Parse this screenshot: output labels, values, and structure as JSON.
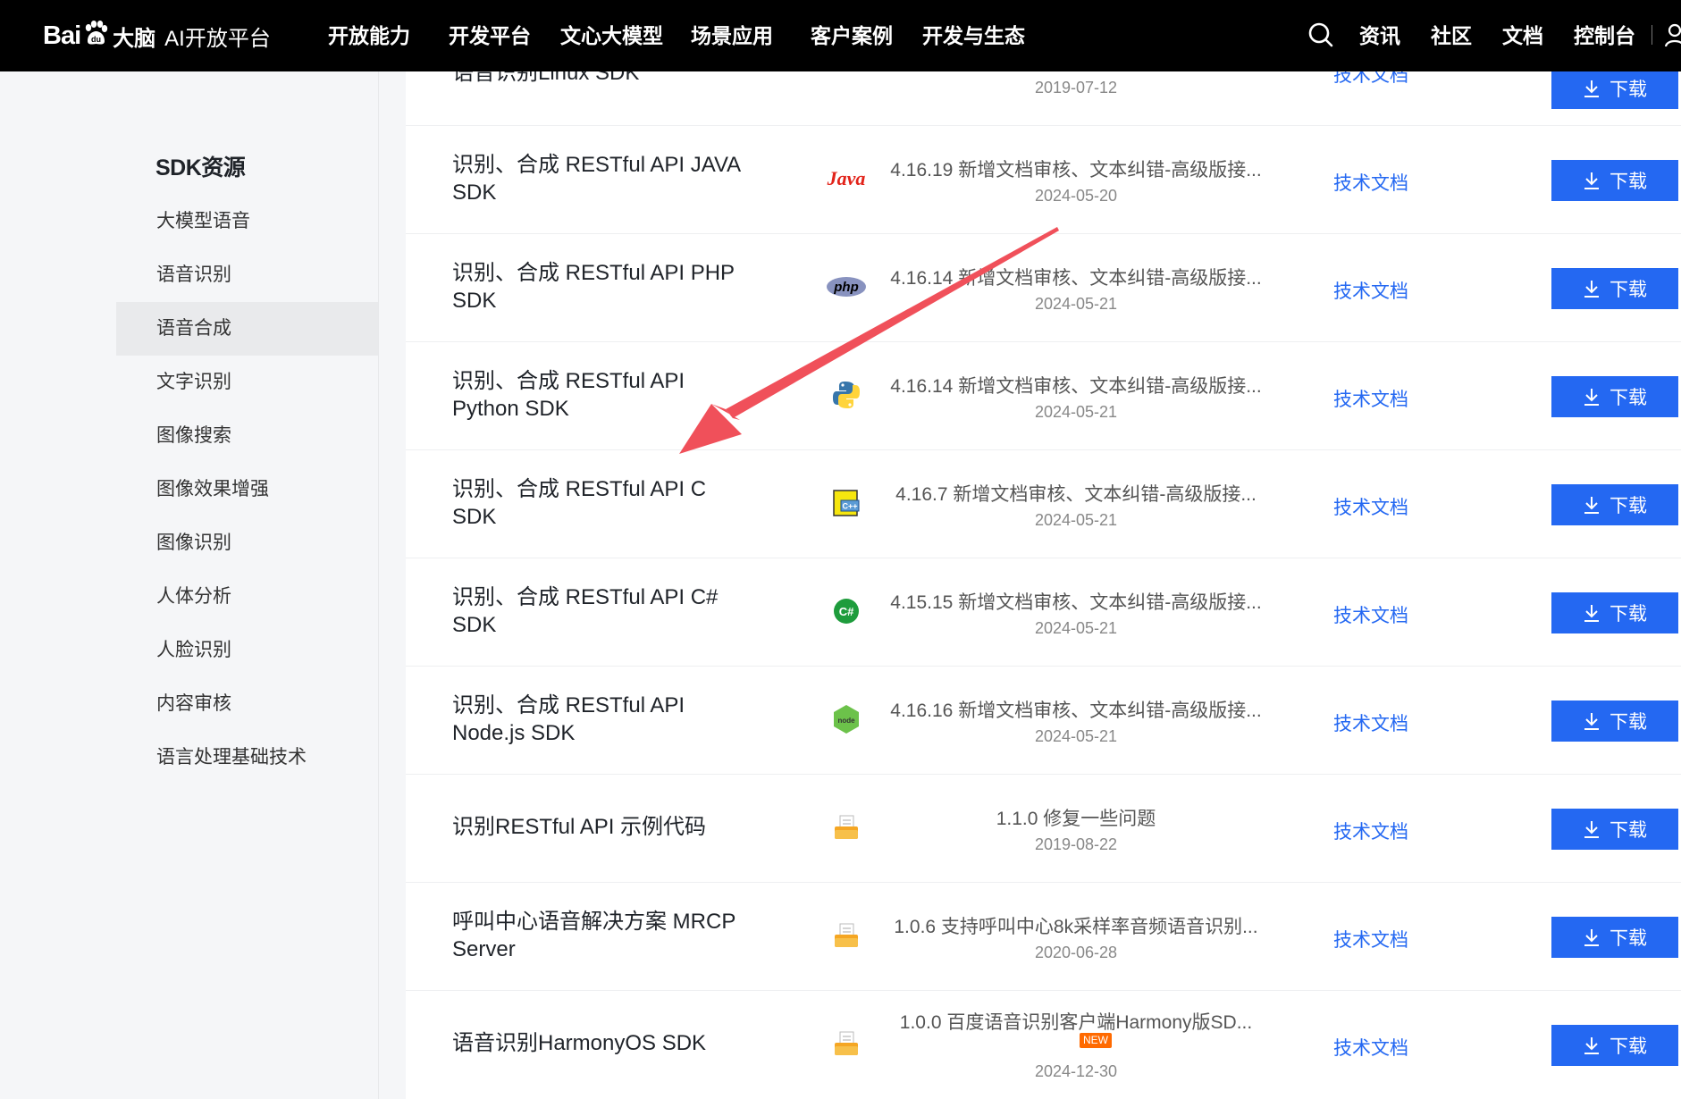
{
  "header": {
    "logo_bai": "Bai",
    "logo_du": "大脑",
    "logo_platform": "AI开放平台",
    "nav": [
      "开放能力",
      "开发平台",
      "文心大模型",
      "场景应用",
      "客户案例",
      "开发与生态"
    ],
    "right": [
      "资讯",
      "社区",
      "文档",
      "控制台"
    ]
  },
  "sidebar": {
    "title": "SDK资源",
    "items": [
      "大模型语音",
      "语音识别",
      "语音合成",
      "文字识别",
      "图像搜索",
      "图像效果增强",
      "图像识别",
      "人体分析",
      "人脸识别",
      "内容审核",
      "语言处理基础技术"
    ],
    "active_index": 2
  },
  "rows": [
    {
      "name": "语音识别Linux SDK",
      "icon": "linux-icon",
      "version": "",
      "date": "2019-07-12",
      "doc": "技术文档",
      "download": "下载"
    },
    {
      "name": "识别、合成 RESTful API JAVA SDK",
      "icon": "java-icon",
      "icon_text": "Java",
      "version": "4.16.19 新增文档审核、文本纠错-高级版接...",
      "date": "2024-05-20",
      "doc": "技术文档",
      "download": "下载"
    },
    {
      "name": "识别、合成 RESTful API PHP SDK",
      "icon": "php-icon",
      "icon_text": "php",
      "version": "4.16.14 新增文档审核、文本纠错-高级版接...",
      "date": "2024-05-21",
      "doc": "技术文档",
      "download": "下载"
    },
    {
      "name": "识别、合成 RESTful API Python SDK",
      "icon": "python-icon",
      "version": "4.16.14 新增文档审核、文本纠错-高级版接...",
      "date": "2024-05-21",
      "doc": "技术文档",
      "download": "下载"
    },
    {
      "name": "识别、合成 RESTful API C SDK",
      "icon": "cpp-icon",
      "icon_text": "C++",
      "version": "4.16.7 新增文档审核、文本纠错-高级版接...",
      "date": "2024-05-21",
      "doc": "技术文档",
      "download": "下载"
    },
    {
      "name": "识别、合成 RESTful API C# SDK",
      "icon": "csharp-icon",
      "icon_text": "C#",
      "version": "4.15.15 新增文档审核、文本纠错-高级版接...",
      "date": "2024-05-21",
      "doc": "技术文档",
      "download": "下载"
    },
    {
      "name": "识别、合成 RESTful API Node.js SDK",
      "icon": "nodejs-icon",
      "icon_text": "node",
      "version": "4.16.16 新增文档审核、文本纠错-高级版接...",
      "date": "2024-05-21",
      "doc": "技术文档",
      "download": "下载"
    },
    {
      "name": "识别RESTful API 示例代码",
      "icon": "file-icon",
      "version": "1.1.0 修复一些问题",
      "date": "2019-08-22",
      "doc": "技术文档",
      "download": "下载"
    },
    {
      "name": "呼叫中心语音解决方案 MRCP Server",
      "icon": "file-icon",
      "version": "1.0.6 支持呼叫中心8k采样率音频语音识别...",
      "date": "2020-06-28",
      "doc": "技术文档",
      "download": "下载"
    },
    {
      "name": "语音识别HarmonyOS SDK",
      "icon": "file-icon",
      "version": "1.0.0 百度语音识别客户端Harmony版SD...",
      "badge": "NEW",
      "date": "2024-12-30",
      "doc": "技术文档",
      "download": "下载"
    }
  ],
  "colors": {
    "nav_bg": "#000000",
    "accent": "#2468f2",
    "arrow": "#f0505a",
    "new_badge": "#ff6a00"
  }
}
